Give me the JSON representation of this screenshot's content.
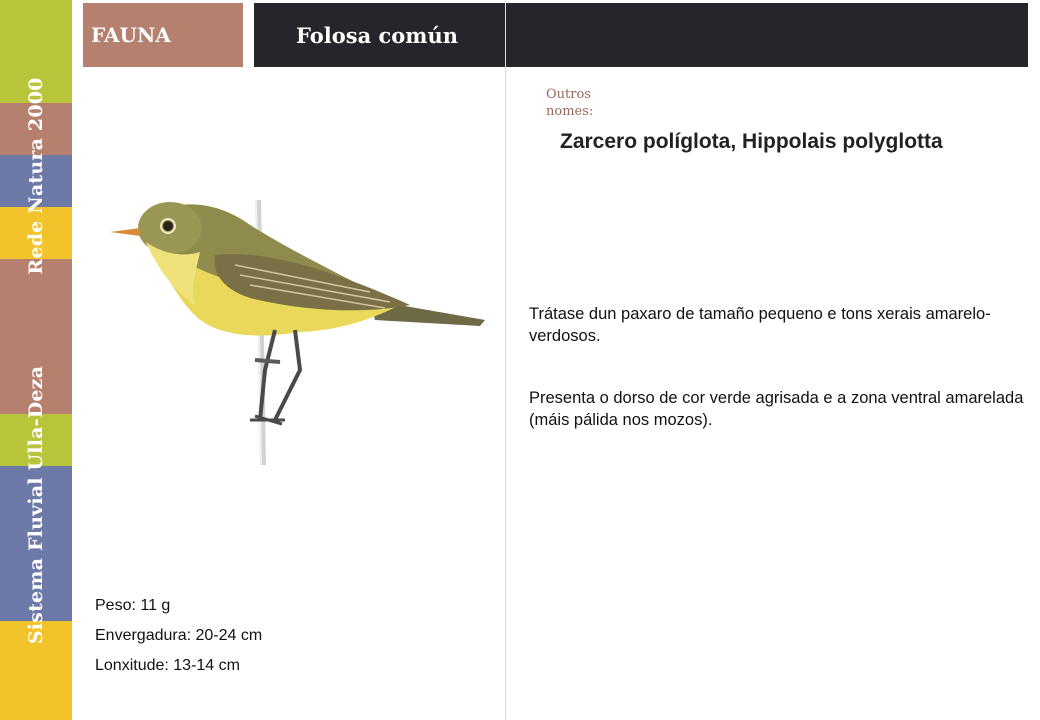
{
  "sidebar": {
    "text_top": "Rede Natura 2000",
    "text_bottom": "Sistema Fluvial Ulla-Deza",
    "colors": [
      "#b8c43a",
      "#b5816e",
      "#6d79a6",
      "#f2c32b",
      "#b5816e",
      "#b8c43a",
      "#6d79a6",
      "#f2c32b"
    ]
  },
  "header": {
    "category": "FAUNA",
    "title": "Folosa común"
  },
  "other_names": {
    "label": "Outros nomes:",
    "value": "Zarcero políglota, Hippolais polyglotta"
  },
  "description": {
    "p1": "Trátase dun paxaro de tamaño pequeno e tons xerais amarelo-verdosos.",
    "p2": "Presenta o dorso de cor verde agrisada e a zona ventral amarelada (máis pálida nos mozos)."
  },
  "stats": {
    "weight": "Peso: 11 g",
    "wingspan": "Envergadura: 20-24 cm",
    "length": "Lonxitude: 13-14 cm"
  }
}
